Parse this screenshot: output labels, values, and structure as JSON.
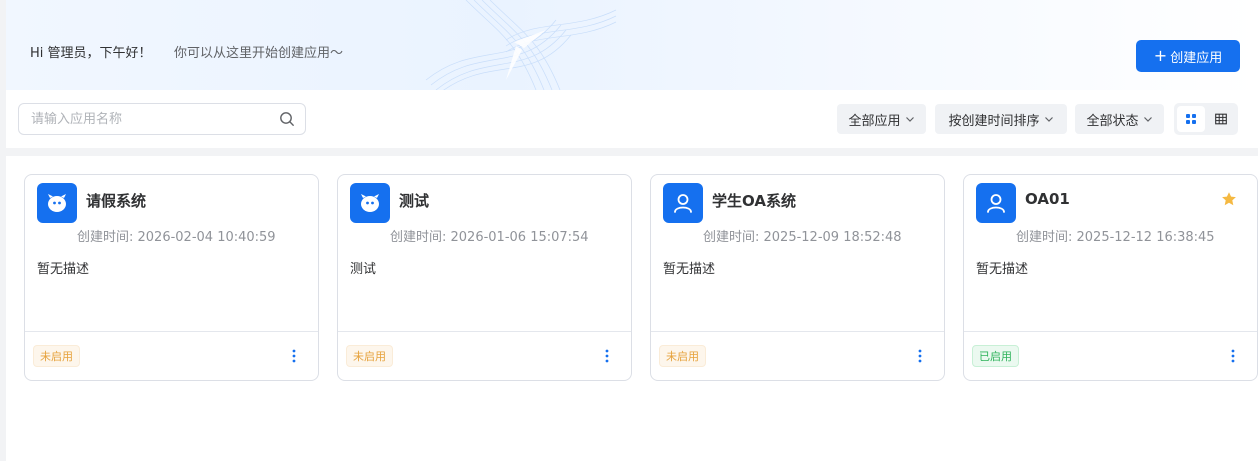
{
  "banner": {
    "greeting": "Hi 管理员，下午好！",
    "subtitle": "你可以从这里开始创建应用～",
    "create_label": "创建应用"
  },
  "toolbar": {
    "search_placeholder": "请输入应用名称",
    "filters": [
      {
        "label": "全部应用"
      },
      {
        "label": "按创建时间排序"
      },
      {
        "label": "全部状态"
      }
    ],
    "view_active": "card"
  },
  "cards": [
    {
      "title": "请假系统",
      "time": "创建时间: 2026-02-04 10:40:59",
      "desc": "暂无描述",
      "status": "未启用",
      "status_type": "off",
      "icon": "bot-icon",
      "starred": false
    },
    {
      "title": "测试",
      "time": "创建时间: 2026-01-06 15:07:54",
      "desc": "测试",
      "status": "未启用",
      "status_type": "off",
      "icon": "bot-icon",
      "starred": false
    },
    {
      "title": "学生OA系统",
      "time": "创建时间: 2025-12-09 18:52:48",
      "desc": "暂无描述",
      "status": "未启用",
      "status_type": "off",
      "icon": "user-icon",
      "starred": false
    },
    {
      "title": "OA01",
      "time": "创建时间: 2025-12-12 16:38:45",
      "desc": "暂无描述",
      "status": "已启用",
      "status_type": "on",
      "icon": "user-icon",
      "starred": true
    }
  ],
  "colors": {
    "primary": "#1570ef",
    "star": "#f5b942",
    "status_off": "#e6a23c",
    "status_on": "#2fb35b"
  }
}
